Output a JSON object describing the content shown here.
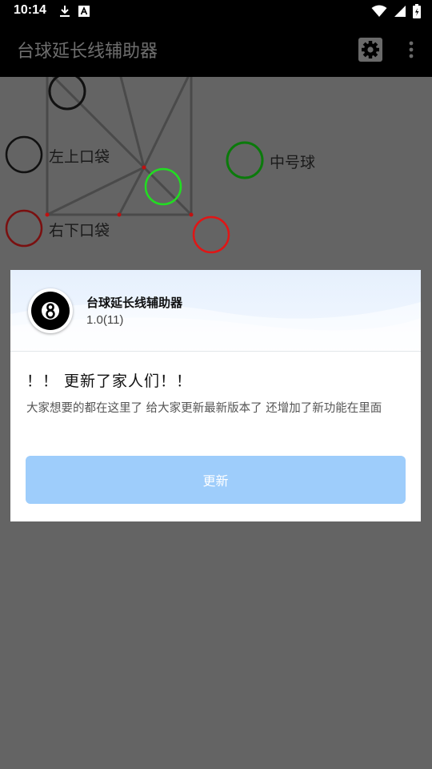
{
  "status_bar": {
    "time": "10:14",
    "left_icons": [
      "download-icon",
      "a-badge-icon"
    ],
    "right_icons": [
      "wifi-icon",
      "cell-signal-icon",
      "battery-icon"
    ]
  },
  "app_bar": {
    "title": "台球延长线辅助器",
    "settings_icon": "gear-icon",
    "more_icon": "more-vert-icon"
  },
  "canvas": {
    "labels": {
      "top_left_pocket": "左上口袋",
      "bottom_right_pocket": "右下口袋",
      "middle_ball": "中号球"
    },
    "colors": {
      "line": "#4a4a4a",
      "ring_black": "#111111",
      "ring_dark_red": "#7a1010",
      "ring_dark_green": "#0b7a0b",
      "ring_bright_green": "#22dd22",
      "ring_red": "#e01616",
      "dot_red": "#c01010"
    }
  },
  "dialog": {
    "app_name": "台球延长线辅助器",
    "version": "1.0(11)",
    "icon": "eight-ball-icon",
    "update_title": "！！ 更新了家人们！！",
    "update_description": "大家想要的都在这里了 给大家更新最新版本了 还增加了新功能在里面",
    "update_button": "更新",
    "colors": {
      "button": "#9ecdfb",
      "header": "#e6f0fd"
    }
  }
}
